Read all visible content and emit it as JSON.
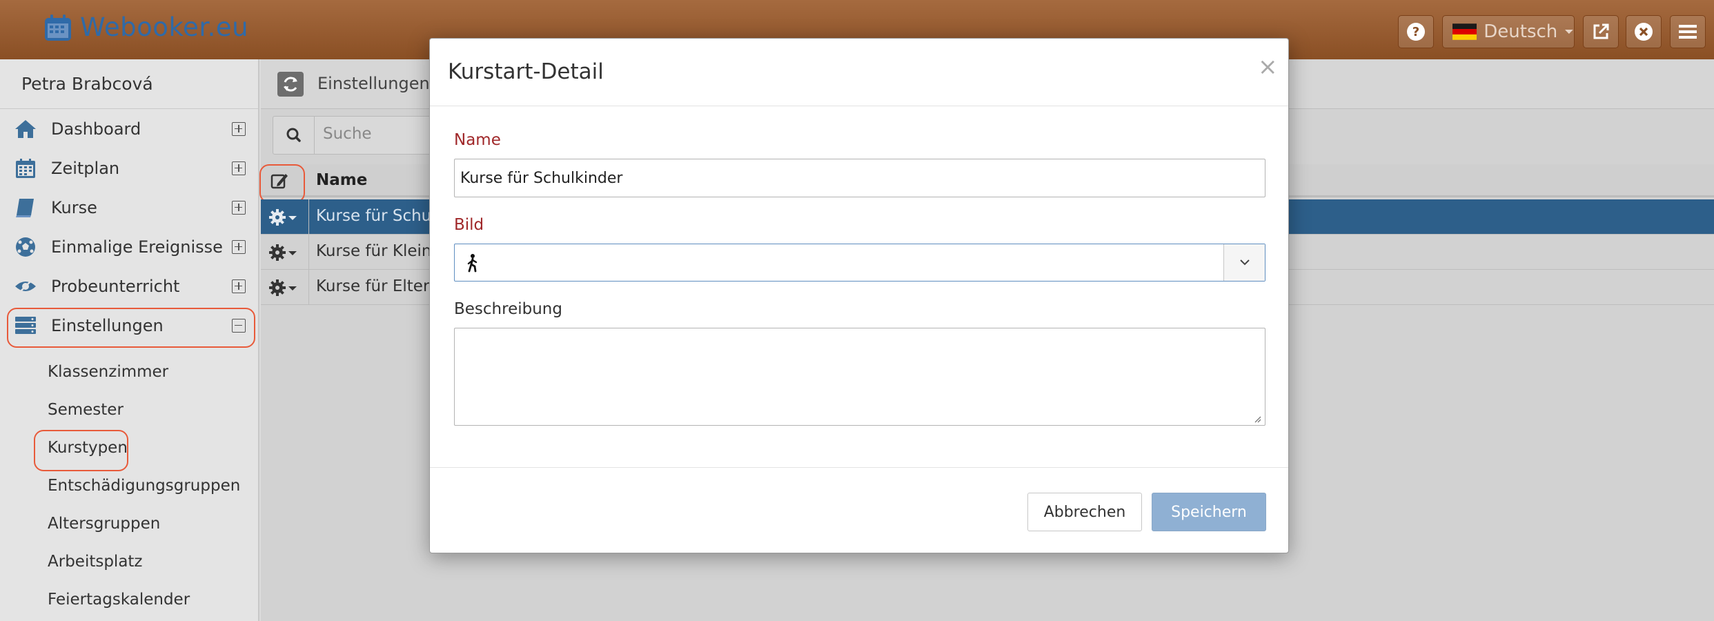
{
  "app": {
    "logo_text": "Webooker.eu",
    "language": "Deutsch"
  },
  "sidebar": {
    "user": "Petra Brabcová",
    "items": [
      {
        "label": "Dashboard",
        "icon": "home-icon",
        "expanded": false
      },
      {
        "label": "Zeitplan",
        "icon": "calendar-icon",
        "expanded": false
      },
      {
        "label": "Kurse",
        "icon": "book-icon",
        "expanded": false
      },
      {
        "label": "Einmalige Ereignisse",
        "icon": "soccer-ball-icon",
        "expanded": false
      },
      {
        "label": "Probeunterricht",
        "icon": "eye-icon",
        "expanded": false
      },
      {
        "label": "Einstellungen",
        "icon": "server-icon",
        "expanded": true
      }
    ],
    "sub_items": [
      "Klassenzimmer",
      "Semester",
      "Kurstypen",
      "Entschädigungsgruppen",
      "Altersgruppen",
      "Arbeitsplatz",
      "Feiertagskalender"
    ]
  },
  "main": {
    "breadcrumb": "Einstellungen /",
    "search_placeholder": "Suche",
    "table": {
      "header_name": "Name",
      "rows": [
        {
          "name": "Kurse für Schul",
          "selected": true
        },
        {
          "name": "Kurse für Kleink",
          "selected": false
        },
        {
          "name": "Kurse für Eltern",
          "selected": false
        }
      ]
    }
  },
  "modal": {
    "title": "Kurstart-Detail",
    "close": "×",
    "name_label": "Name",
    "name_value": "Kurse für Schulkinder",
    "image_label": "Bild",
    "image_icon": "walking-person-icon",
    "description_label": "Beschreibung",
    "description_value": "",
    "cancel_label": "Abbrechen",
    "save_label": "Speichern"
  },
  "colors": {
    "header": "#8a4f24",
    "accent_blue": "#2d5f8a",
    "required_label": "#a0282a",
    "save_button": "#8fb0d3",
    "highlight": "#e85a3a"
  }
}
